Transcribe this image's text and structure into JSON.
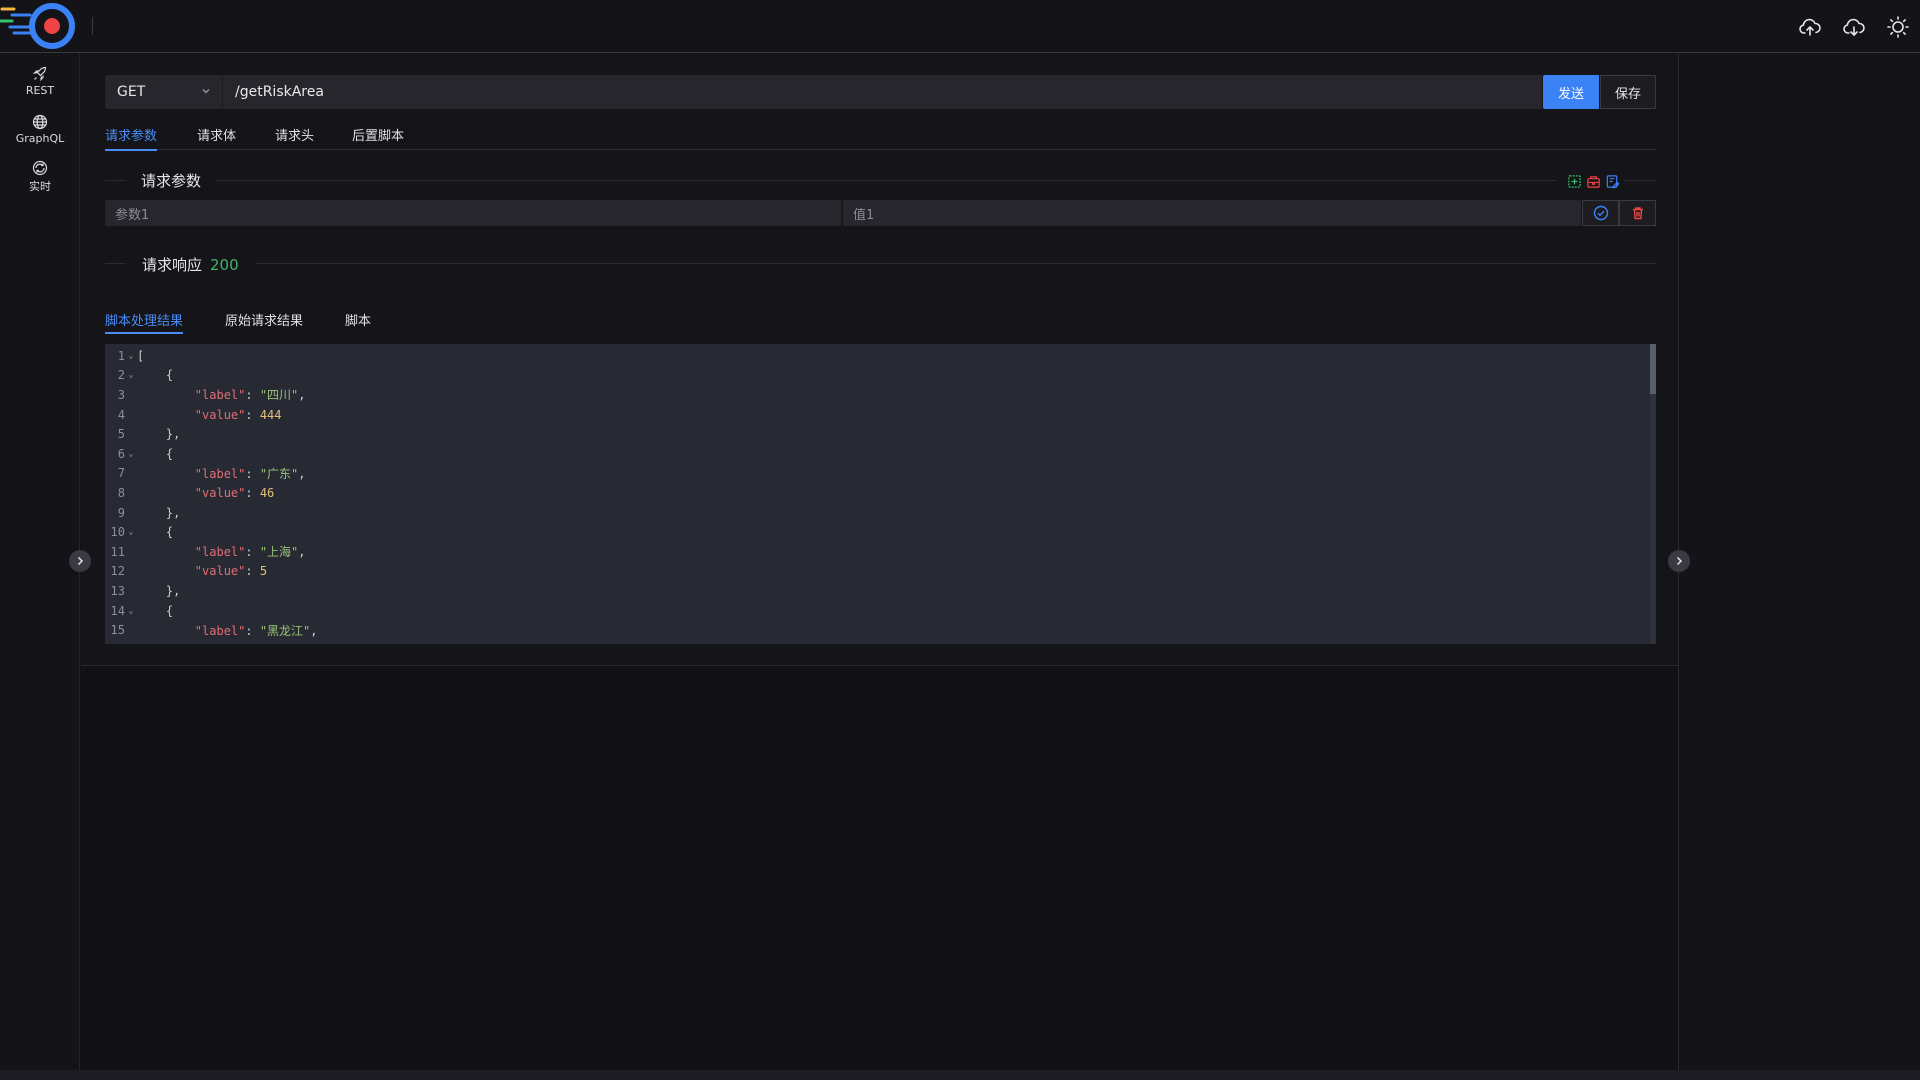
{
  "app": {
    "colors": {
      "accent": "#3b82f6",
      "status_ok": "#3fb66b",
      "danger": "#ef4444"
    }
  },
  "topbar": {
    "icons": [
      "cloud-upload-icon",
      "cloud-download-icon",
      "sun-icon"
    ]
  },
  "sidebar": {
    "items": [
      {
        "label": "REST",
        "icon": "rocket-icon"
      },
      {
        "label": "GraphQL",
        "icon": "globe-icon"
      },
      {
        "label": "实时",
        "icon": "realtime-icon"
      }
    ]
  },
  "request": {
    "method": "GET",
    "url": "/getRiskArea",
    "send_label": "发送",
    "save_label": "保存"
  },
  "request_tabs": [
    {
      "label": "请求参数",
      "active": true
    },
    {
      "label": "请求体",
      "active": false
    },
    {
      "label": "请求头",
      "active": false
    },
    {
      "label": "后置脚本",
      "active": false
    }
  ],
  "params_section": {
    "title": "请求参数",
    "actions": [
      "add-param-icon",
      "bulk-delete-icon",
      "edit-list-icon"
    ],
    "row": {
      "key_placeholder": "参数1",
      "value_placeholder": "值1"
    }
  },
  "response_section": {
    "title": "请求响应",
    "status": "200",
    "tabs": [
      {
        "label": "脚本处理结果",
        "active": true
      },
      {
        "label": "原始请求结果",
        "active": false
      },
      {
        "label": "脚本",
        "active": false
      }
    ]
  },
  "editor": {
    "lines": [
      {
        "n": "1",
        "fold": true,
        "indent": "",
        "kind": "open-bracket"
      },
      {
        "n": "2",
        "fold": true,
        "indent": "    ",
        "kind": "open-brace"
      },
      {
        "n": "3",
        "fold": false,
        "indent": "        ",
        "kind": "pair-str",
        "key": "\"label\"",
        "val": "\"四川\"",
        "trail": ","
      },
      {
        "n": "4",
        "fold": false,
        "indent": "        ",
        "kind": "pair-num",
        "key": "\"value\"",
        "val": "444",
        "trail": ""
      },
      {
        "n": "5",
        "fold": false,
        "indent": "    ",
        "kind": "close-brace"
      },
      {
        "n": "6",
        "fold": true,
        "indent": "    ",
        "kind": "open-brace"
      },
      {
        "n": "7",
        "fold": false,
        "indent": "        ",
        "kind": "pair-str",
        "key": "\"label\"",
        "val": "\"广东\"",
        "trail": ","
      },
      {
        "n": "8",
        "fold": false,
        "indent": "        ",
        "kind": "pair-num",
        "key": "\"value\"",
        "val": "46",
        "trail": ""
      },
      {
        "n": "9",
        "fold": false,
        "indent": "    ",
        "kind": "close-brace"
      },
      {
        "n": "10",
        "fold": true,
        "indent": "    ",
        "kind": "open-brace"
      },
      {
        "n": "11",
        "fold": false,
        "indent": "        ",
        "kind": "pair-str",
        "key": "\"label\"",
        "val": "\"上海\"",
        "trail": ","
      },
      {
        "n": "12",
        "fold": false,
        "indent": "        ",
        "kind": "pair-num",
        "key": "\"value\"",
        "val": "5",
        "trail": ""
      },
      {
        "n": "13",
        "fold": false,
        "indent": "    ",
        "kind": "close-brace"
      },
      {
        "n": "14",
        "fold": true,
        "indent": "    ",
        "kind": "open-brace"
      },
      {
        "n": "15",
        "fold": false,
        "indent": "        ",
        "kind": "pair-str",
        "key": "\"label\"",
        "val": "\"黑龙江\"",
        "trail": ","
      }
    ]
  }
}
